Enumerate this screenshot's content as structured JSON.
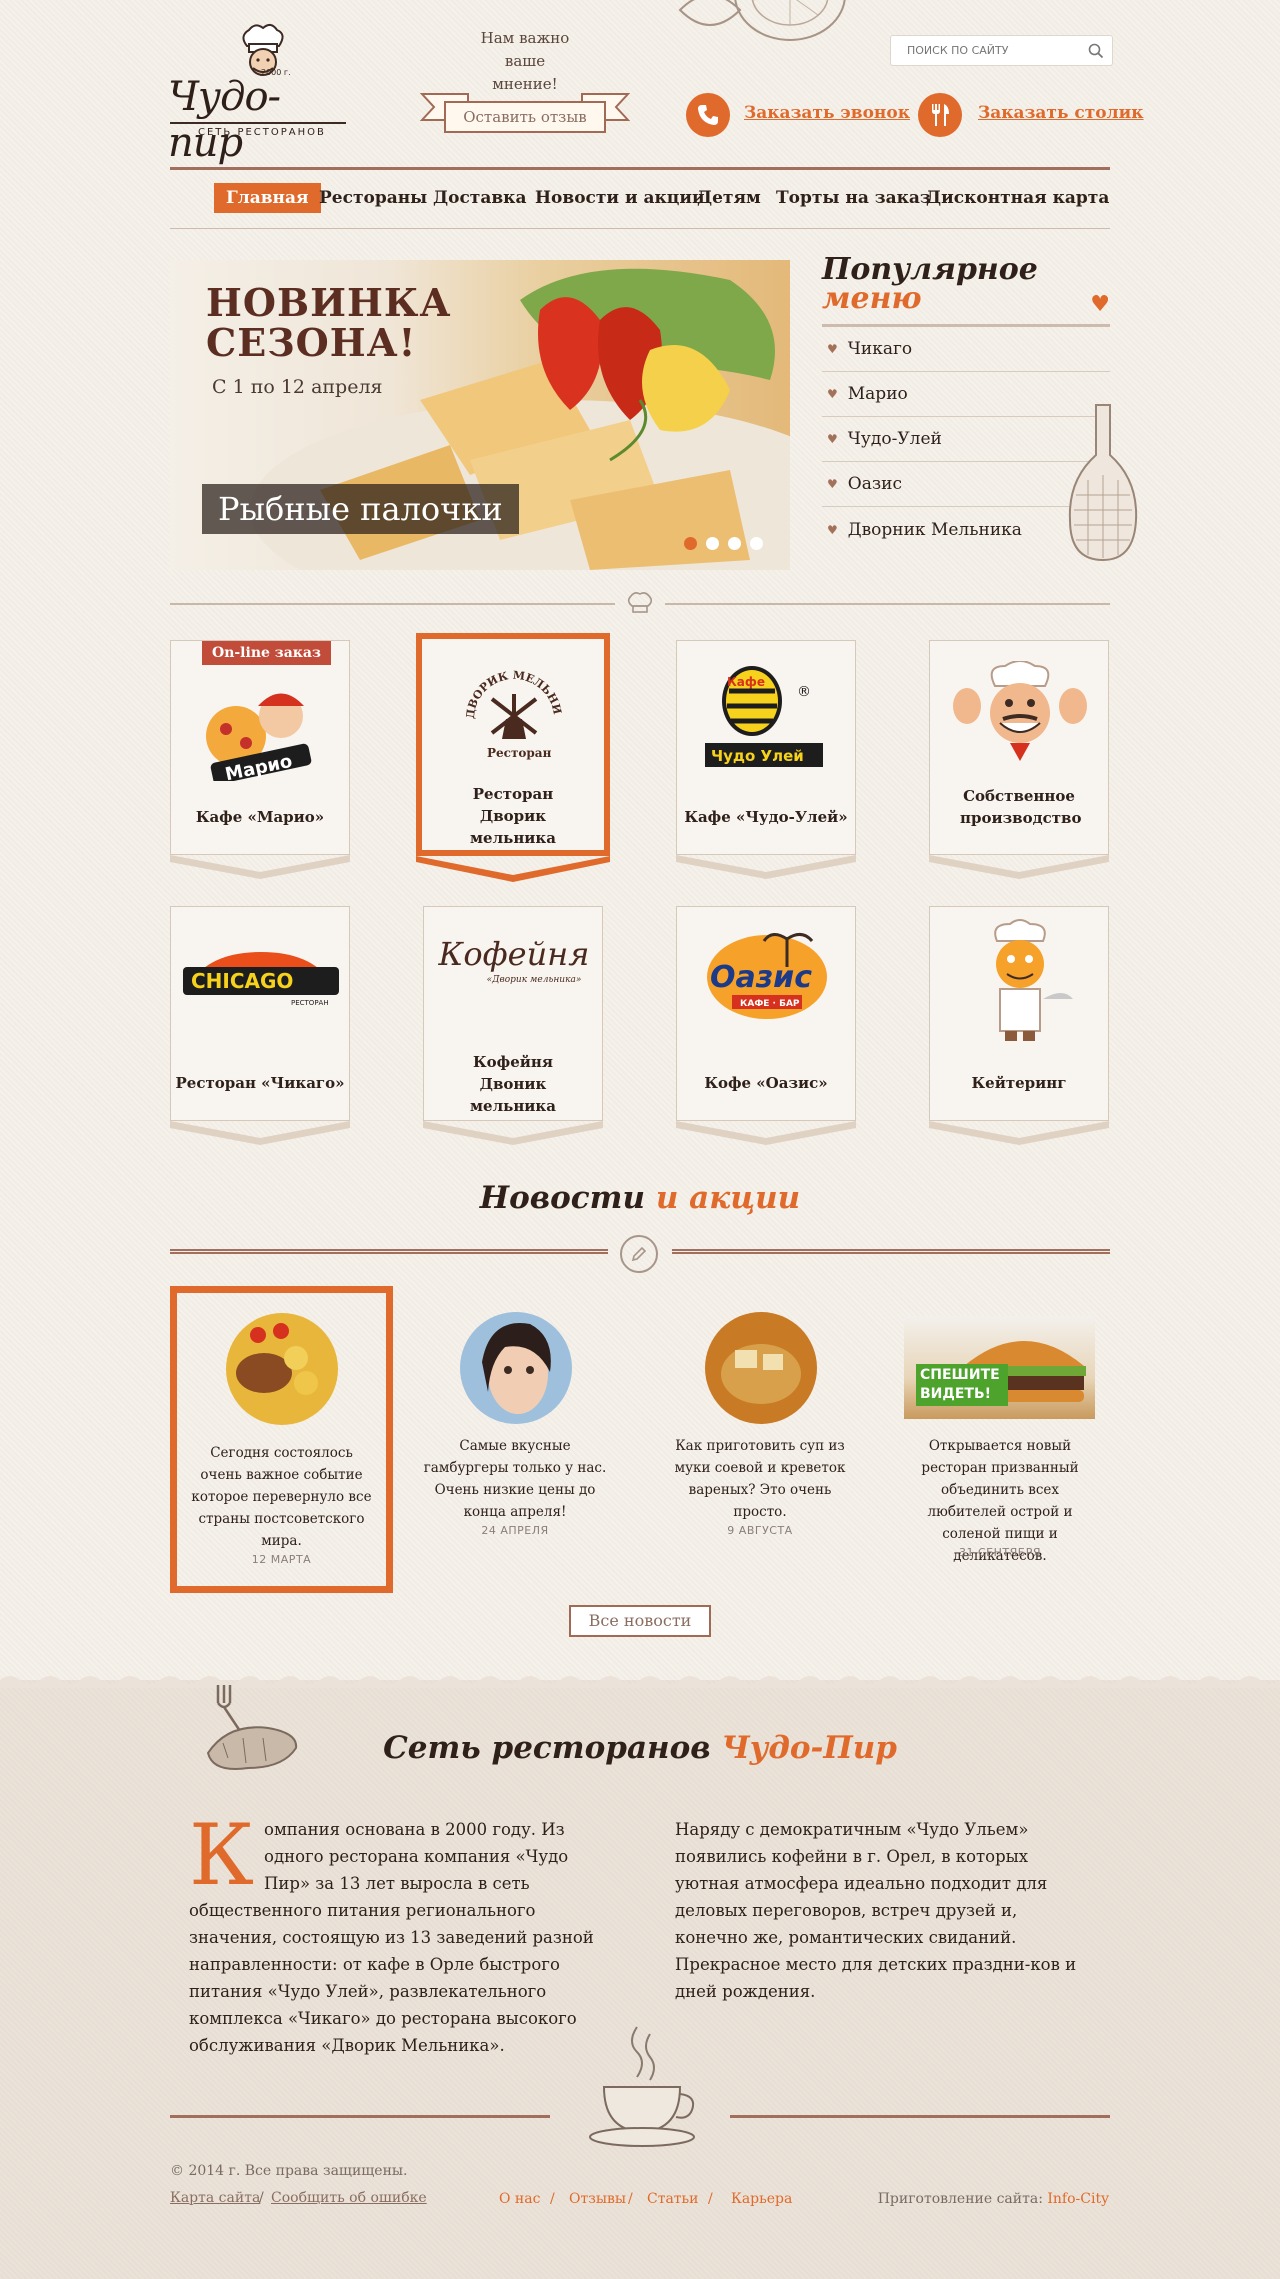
{
  "header": {
    "logo_text": "Чудо-пир",
    "logo_sub": "СЕТЬ РЕСТОРАНОВ",
    "logo_year": "2000 г.",
    "feedback_q": "Нам важно ваше мнение!",
    "feedback_btn": "Оставить отзыв",
    "search_placeholder": "ПОИСК ПО САЙТУ",
    "call_label": "Заказать эвонок",
    "table_label": "Заказать столик"
  },
  "nav": [
    "Главная",
    "Рестораны",
    "Доставка",
    "Новости и акции",
    "Детям",
    "Торты на заказ",
    "Дисконтная карта"
  ],
  "slider": {
    "title1": "НОВИНКА",
    "title2": "СЕЗОНА!",
    "date": "С 1 по 12 апреля",
    "caption": "Рыбные палочки",
    "dots": 4,
    "active_dot": 0
  },
  "popular": {
    "title1": "Популярное",
    "title2": "меню",
    "items": [
      "Чикаго",
      "Марио",
      "Чудо-Улей",
      "Оазис",
      "Дворник Мельника"
    ]
  },
  "restaurants": [
    {
      "label": "Кафе «Марио»",
      "logo": "Марио",
      "badge": "On-line заказ"
    },
    {
      "label": "Ресторан Дворик мельника",
      "logo_top": "ДВОРИК МЕЛЬНИКА",
      "logo_bottom": "Ресторан"
    },
    {
      "label": "Кафе «Чудо-Улей»",
      "logo_top": "Кафе",
      "logo": "Чудо Улей"
    },
    {
      "label": "Собственное производство"
    },
    {
      "label": "Ресторан «Чикаго»",
      "logo": "CHICAGO",
      "logo_sub": "РЕСТОРАН"
    },
    {
      "label": "Кофейня Двоник мельника",
      "logo": "Кофейня",
      "logo_sub": "«Дворик мельника»"
    },
    {
      "label": "Кофе «Оазис»",
      "logo": "Оазис",
      "logo_sub": "КАФЕ · БАР"
    },
    {
      "label": "Кейтеринг"
    }
  ],
  "news": {
    "title1": "Новости",
    "title2": "и акции",
    "items": [
      {
        "text": "Сегодня состоялось очень важное событие которое перевернуло все страны постсоветского мира.",
        "date": "12 МАРТА"
      },
      {
        "text": "Самые вкусные гамбургеры только у нас. Очень низкие цены до конца апреля!",
        "date": "24 АПРЕЛЯ"
      },
      {
        "text": "Как приготовить суп из муки соевой и креветок вареных? Это очень просто.",
        "date": "9 АВГУСТА"
      },
      {
        "text": "Открывается новый ресторан призванный объединить всех любителей острой и соленой пищи и деликатесов.",
        "date": "31 СЕНТЯБРЯ",
        "banner": "СПЕШИТЕ ВИДЕТЬ!"
      }
    ],
    "all_btn": "Все новости"
  },
  "about": {
    "title1": "Сеть ресторанов",
    "title2": "Чудо-Пир",
    "dropcap": "К",
    "col1": "омпания основана в 2000 году. Из одного ресторана компания «Чудо Пир» за 13 лет выросла в сеть общественного питания регионального значения,  состоящую из 13 заведений разной направленности: от кафе в Орле быстрого питания «Чудо Улей», развлекательного комплекса «Чикаго» до ресторана высокого обслуживания «Дворик Мельника».",
    "col2": "Наряду с демократичным «Чудо Ульем» появились кофейни в г. Орел, в которых уютная атмосфера идеально подходит для деловых переговоров, встреч друзей и, конечно же, романтических свиданий. Прекрасное место для детских праздни-ков и дней рождения."
  },
  "footer": {
    "copyright": "© 2014 г. Все права защищены.",
    "sitemap": "Карта сайта",
    "sep": "/",
    "report": "Сообщить об ошибке",
    "links": [
      "О нас",
      "Отзывы",
      "Статьи",
      "Карьера"
    ],
    "made_by": "Приготовление сайта:",
    "studio": "Info-City"
  },
  "colors": {
    "accent": "#e06a2b",
    "brown": "#a16f5c",
    "dark": "#2f201a"
  }
}
